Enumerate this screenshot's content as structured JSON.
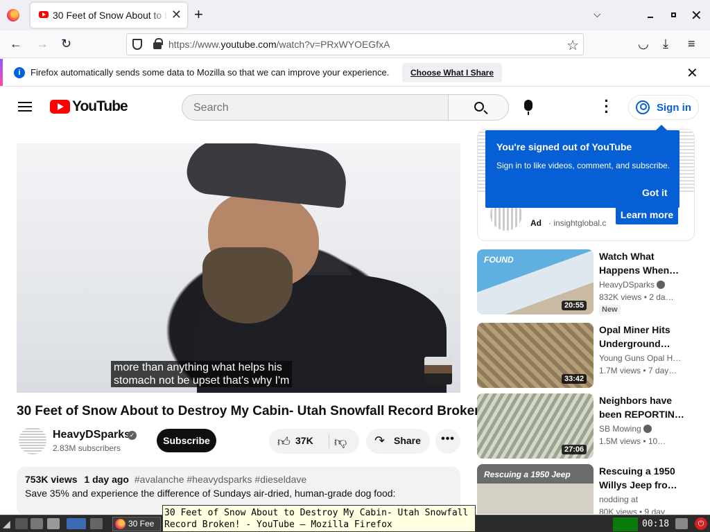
{
  "browser": {
    "tab_title": "30 Feet of Snow About to Destroy My Cabin- Utah Snowfall Record Broken! - YouTube",
    "url_prefix": "https://www.",
    "url_domain": "youtube.com",
    "url_path": "/watch?v=PRxWYOEGfxA",
    "notification_text": "Firefox automatically sends some data to Mozilla so that we can improve your experience.",
    "notification_button": "Choose What I Share"
  },
  "youtube": {
    "logo_text": "YouTube",
    "search_placeholder": "Search",
    "sign_in": "Sign in"
  },
  "video": {
    "caption_line1": "more than anything what helps his",
    "caption_line2": "stomach not be upset that's why I'm",
    "title": "30 Feet of Snow About to Destroy My Cabin- Utah Snowfall Record Broken!",
    "channel": "HeavyDSparks",
    "subscribers": "2.83M subscribers",
    "subscribe_label": "Subscribe",
    "likes": "37K",
    "share_label": "Share",
    "more_label": "•••",
    "views": "753K views",
    "age": "1 day ago",
    "tags": "#avalanche #heavydsparks #dieseldave",
    "description_line": "Save 35% and experience the difference of Sundays air-dried, human-grade dog food:"
  },
  "popup": {
    "heading": "You're signed out of YouTube",
    "text": "Sign in to like videos, comment, and subscribe.",
    "got_it": "Got it",
    "learn_more": "Learn more"
  },
  "ad": {
    "label": "Ad",
    "source": "· insightglobal.c"
  },
  "recommendations": [
    {
      "title": "Watch What Happens When…",
      "channel": "HeavyDSparks",
      "meta": "832K views  • 2 da…",
      "badge": "New",
      "duration": "20:55",
      "thumb_text": "FOUND"
    },
    {
      "title": "Opal Miner Hits Underground…",
      "channel": "Young Guns Opal H…",
      "meta": "1.7M views  • 7 day…",
      "duration": "33:42"
    },
    {
      "title": "Neighbors have been REPORTIN…",
      "channel": "SB Mowing",
      "meta": "1.5M views  • 10…",
      "duration": "27:06"
    },
    {
      "title": "Rescuing a 1950 Willys Jeep fro…",
      "channel": "nodding at",
      "meta": "80K views  • 9 day",
      "thumb_text": "Rescuing a 1950 Jeep"
    }
  ],
  "taskbar": {
    "task_label": "30 Fee",
    "clock": "00:18",
    "tooltip": "30 Feet of Snow About to Destroy My Cabin- Utah Snowfall Record Broken! - YouTube — Mozilla Firefox"
  },
  "icons": {
    "accent": "#065fd4",
    "brand_red": "#ff0000"
  }
}
